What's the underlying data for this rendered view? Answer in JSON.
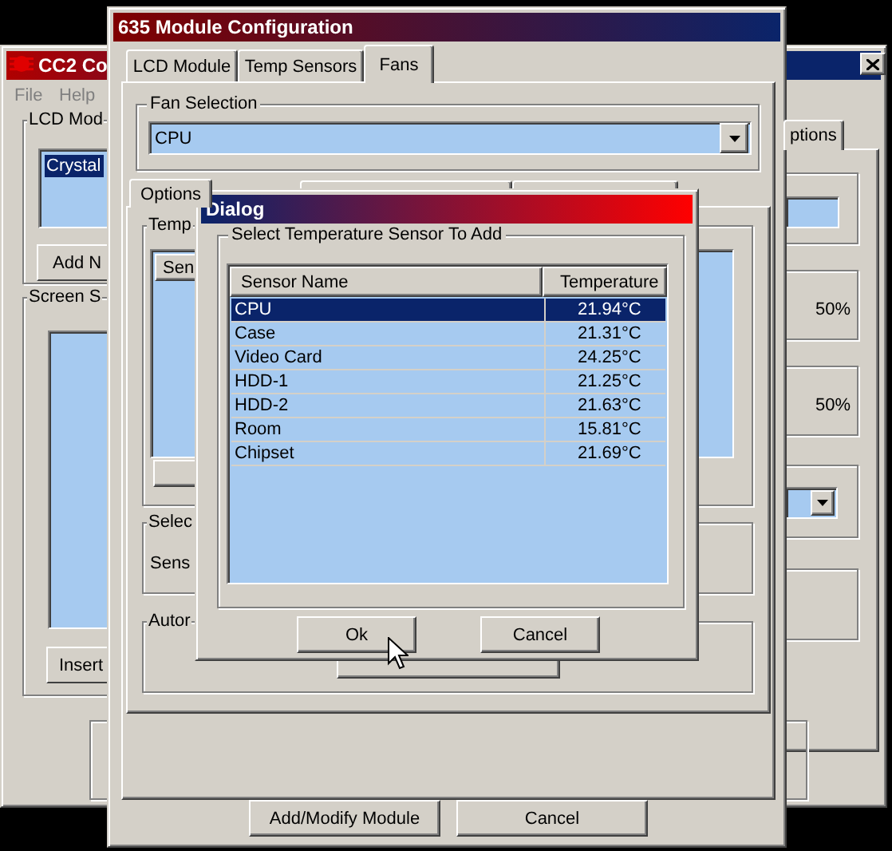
{
  "back_window": {
    "title": "CC2 Co",
    "menu": [
      {
        "label": "File"
      },
      {
        "label": "Help"
      }
    ],
    "lcd_group": {
      "label": "LCD Mod",
      "items": [
        {
          "label": "Crystal",
          "selected": true
        }
      ],
      "button": "Add N"
    },
    "screen_group": {
      "label": "Screen S",
      "button": "Insert"
    },
    "tab": {
      "label": "ptions"
    },
    "readings": [
      "50%",
      "50%"
    ]
  },
  "config_window": {
    "title": "635 Module Configuration",
    "tabs": [
      {
        "label": "LCD Module",
        "selected": false
      },
      {
        "label": "Temp Sensors",
        "selected": false
      },
      {
        "label": "Fans",
        "selected": true
      }
    ],
    "fan_selection": {
      "label": "Fan Selection",
      "value": "CPU"
    },
    "inner_tabs": [
      {
        "label": "Options",
        "selected": true
      }
    ],
    "temp_group": {
      "label": "Temp",
      "column": "Sen"
    },
    "select_group": {
      "label": "Selec",
      "text": "Sens"
    },
    "auto_group": {
      "label": "Autor"
    },
    "buttons": [
      "Add/Modify Module",
      "Cancel"
    ]
  },
  "dialog": {
    "title": "Dialog",
    "group": "Select Temperature Sensor To Add",
    "columns": [
      "Sensor Name",
      "Temperature"
    ],
    "rows": [
      {
        "name": "CPU",
        "temperature": "21.94°C",
        "selected": true
      },
      {
        "name": "Case",
        "temperature": "21.31°C",
        "selected": false
      },
      {
        "name": "Video Card",
        "temperature": "24.25°C",
        "selected": false
      },
      {
        "name": "HDD-1",
        "temperature": "21.25°C",
        "selected": false
      },
      {
        "name": "HDD-2",
        "temperature": "21.63°C",
        "selected": false
      },
      {
        "name": "Room",
        "temperature": "15.81°C",
        "selected": false
      },
      {
        "name": "Chipset",
        "temperature": "21.69°C",
        "selected": false
      }
    ],
    "buttons": [
      "Ok",
      "Cancel"
    ]
  }
}
